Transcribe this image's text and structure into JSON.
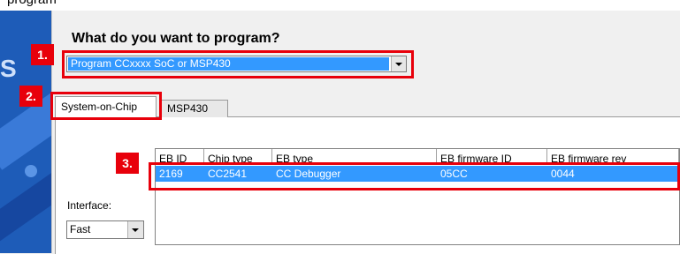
{
  "top_text": "program",
  "side_letter": "S",
  "heading": "What do you want to program?",
  "markers": {
    "m1": "1.",
    "m2": "2.",
    "m3": "3."
  },
  "program_select": {
    "value": "Program CCxxxx SoC or MSP430"
  },
  "tabs": [
    {
      "label": "System-on-Chip",
      "active": true
    },
    {
      "label": "MSP430",
      "active": false
    }
  ],
  "device_list": {
    "columns": [
      "EB ID",
      "Chip type",
      "EB type",
      "EB firmware ID",
      "EB firmware rev"
    ],
    "rows": [
      {
        "eb_id": "2169",
        "chip_type": "CC2541",
        "eb_type": "CC Debugger",
        "fw_id": "05CC",
        "fw_rev": "0044"
      }
    ]
  },
  "interface": {
    "label": "Interface:",
    "value": "Fast"
  },
  "colors": {
    "highlight_red": "#e8000b",
    "selection_blue": "#3399ff",
    "side_blue": "#1e5cb8"
  },
  "icons": {
    "dropdown": "chevron-down-icon"
  }
}
